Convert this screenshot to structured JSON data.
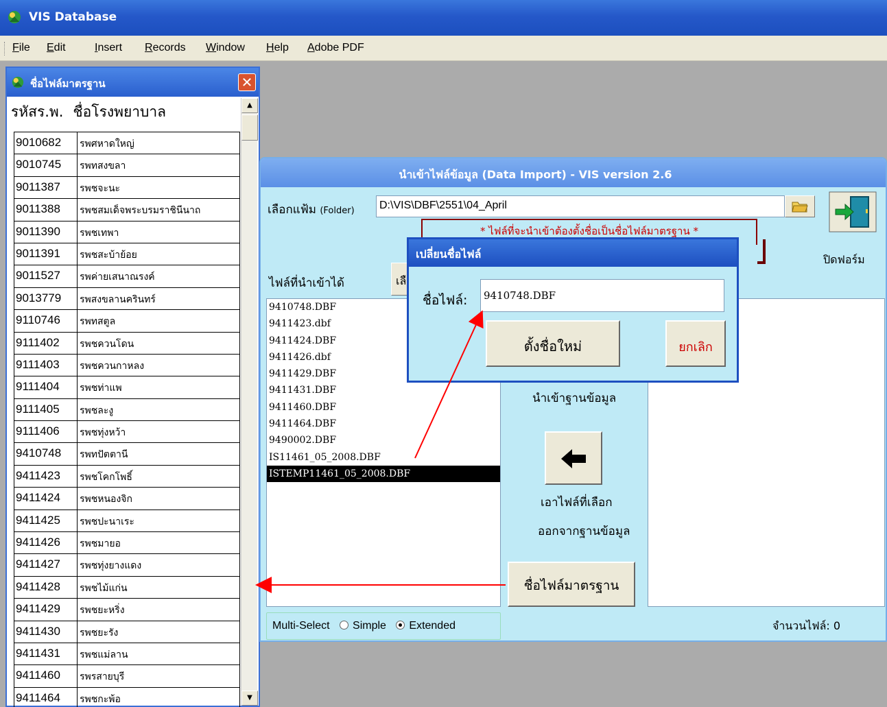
{
  "app": {
    "title": "VIS Database"
  },
  "menu": [
    "File",
    "Edit",
    "Insert",
    "Records",
    "Window",
    "Help",
    "Adobe PDF"
  ],
  "left_panel": {
    "title": "ชื่อไฟล์มาตรฐาน",
    "close": "✕",
    "header_code": "รหัสร.พ.",
    "header_name": "ชื่อโรงพยาบาล",
    "rows": [
      {
        "code": "9010682",
        "name": "รพศหาดใหญ่"
      },
      {
        "code": "9010745",
        "name": "รพทสงขลา"
      },
      {
        "code": "9011387",
        "name": "รพชจะนะ"
      },
      {
        "code": "9011388",
        "name": "รพชสมเด็จพระบรมราชินีนาถ"
      },
      {
        "code": "9011390",
        "name": "รพชเทพา"
      },
      {
        "code": "9011391",
        "name": "รพชสะบ้าย้อย"
      },
      {
        "code": "9011527",
        "name": "รพค่ายเสนาณรงค์"
      },
      {
        "code": "9013779",
        "name": "รพสงขลานครินทร์"
      },
      {
        "code": "9110746",
        "name": "รพทสตูล"
      },
      {
        "code": "9111402",
        "name": "รพชควนโดน"
      },
      {
        "code": "9111403",
        "name": "รพชควนกาหลง"
      },
      {
        "code": "9111404",
        "name": "รพชท่าแพ"
      },
      {
        "code": "9111405",
        "name": "รพชละงู"
      },
      {
        "code": "9111406",
        "name": "รพชทุ่งหว้า"
      },
      {
        "code": "9410748",
        "name": "รพทปัตตานี"
      },
      {
        "code": "9411423",
        "name": "รพชโคกโพธิ์"
      },
      {
        "code": "9411424",
        "name": "รพชหนองจิก"
      },
      {
        "code": "9411425",
        "name": "รพชปะนาเระ"
      },
      {
        "code": "9411426",
        "name": "รพชมายอ"
      },
      {
        "code": "9411427",
        "name": "รพชทุ่งยางแดง"
      },
      {
        "code": "9411428",
        "name": "รพชไม้แก่น"
      },
      {
        "code": "9411429",
        "name": "รพชยะหริ่ง"
      },
      {
        "code": "9411430",
        "name": "รพชยะรัง"
      },
      {
        "code": "9411431",
        "name": "รพชแม่ลาน"
      },
      {
        "code": "9411460",
        "name": "รพรสายบุรี"
      },
      {
        "code": "9411464",
        "name": "รพชกะพ้อ"
      }
    ]
  },
  "import_dialog": {
    "title": "นำเข้าไฟล์ข้อมูล (Data Import) - VIS version 2.6",
    "folder_label": "เลือกแฟ้ม",
    "folder_label_en": "(Folder)",
    "folder_path": "D:\\VIS\\DBF\\2551\\04_April",
    "warning": "* ไฟล์ที่จะนำเข้าต้องตั้งชื่อเป็นชื่อไฟล์มาตรฐาน *",
    "close_label": "ปิดฟอร์ม",
    "files_label": "ไฟล์ที่นำเข้าได้",
    "select_stub": "เลื",
    "files": [
      "9410748.DBF",
      "9411423.dbf",
      "9411424.DBF",
      "9411426.dbf",
      "9411429.DBF",
      "9411431.DBF",
      "9411460.DBF",
      "9411464.DBF",
      "9490002.DBF",
      "IS11461_05_2008.DBF",
      "ISTEMP11461_05_2008.DBF"
    ],
    "selected_file_index": 10,
    "import_label": "นำเข้าฐานข้อมูล",
    "remove_label_1": "เอาไฟล์ที่เลือก",
    "remove_label_2": "ออกจากฐานข้อมูล",
    "std_name_button": "ชื่อไฟล์มาตรฐาน",
    "multiselect_label": "Multi-Select",
    "opt_simple": "Simple",
    "opt_extended": "Extended",
    "multiselect_value": "Extended",
    "file_count": "จำนวนไฟล์: 0"
  },
  "rename_dialog": {
    "title": "เปลี่ยนชื่อไฟล์",
    "label": "ชื่อไฟล์:",
    "value": "9410748.DBF",
    "ok": "ตั้งชื่อใหม่",
    "cancel": "ยกเลิก"
  },
  "colors": {
    "titlebar": "#2558c9",
    "dialog_bg": "#bfeaf6",
    "arrow": "#ff0000",
    "cancel_text": "#cc0000"
  }
}
